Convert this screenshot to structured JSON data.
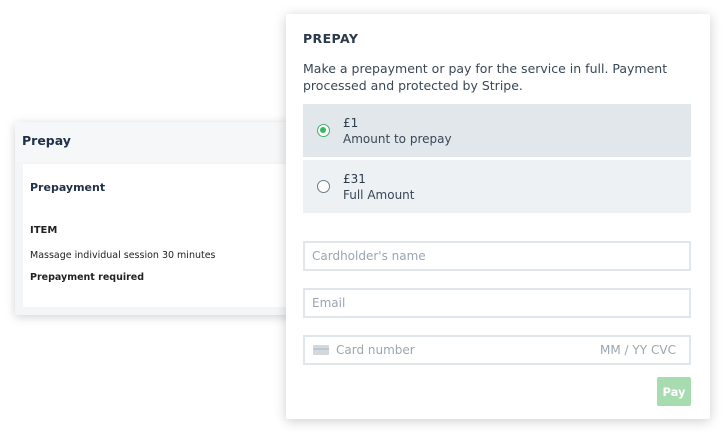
{
  "back_card": {
    "title": "Prepay",
    "subtitle": "Prepayment",
    "item_label": "ITEM",
    "item_description": "Massage individual session 30 minutes",
    "item_note": "Prepayment required"
  },
  "front_card": {
    "title": "PREPAY",
    "description": "Make a prepayment or pay for the service in full. Payment processed and protected by Stripe.",
    "options": [
      {
        "price": "£1",
        "label": "Amount to prepay",
        "selected": true
      },
      {
        "price": "£31",
        "label": "Full Amount",
        "selected": false
      }
    ],
    "fields": {
      "cardholder_placeholder": "Cardholder's name",
      "email_placeholder": "Email",
      "card_number_placeholder": "Card number",
      "expiry_placeholder": "MM / YY",
      "cvc_placeholder": "CVC"
    },
    "pay_label": "Pay"
  },
  "colors": {
    "accent_green": "#3cb563",
    "pay_button_disabled": "#a6dcb0",
    "selected_option_bg": "#e2e7eb"
  },
  "icons": {
    "card": "credit-card-icon",
    "radio_selected": "radio-checked-icon",
    "radio_unselected": "radio-unchecked-icon"
  }
}
